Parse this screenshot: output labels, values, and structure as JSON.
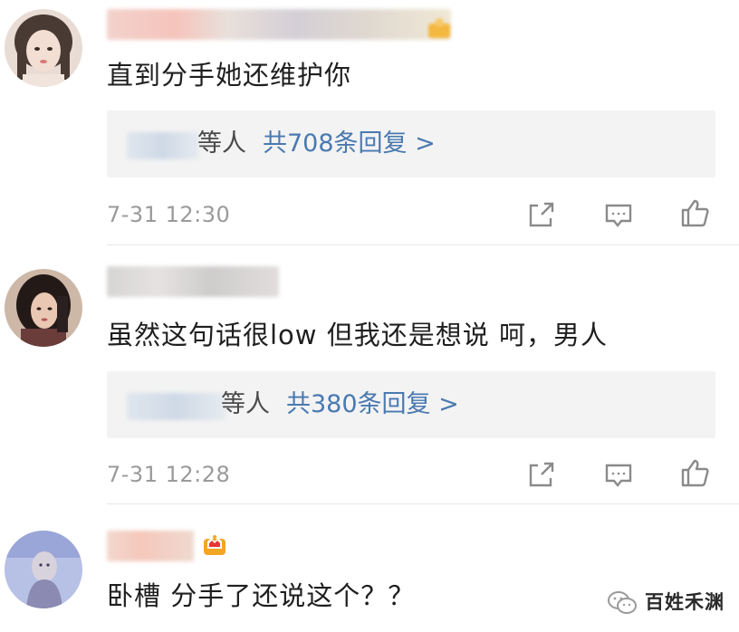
{
  "comments": [
    {
      "text": "直到分手她还维护你",
      "reply_suffix": "等人",
      "reply_count": "共708条回复 >",
      "time": "7-31 12:30"
    },
    {
      "text": "虽然这句话很low  但我还是想说  呵，男人",
      "reply_suffix": "等人",
      "reply_count": "共380条回复 >",
      "time": "7-31 12:28"
    },
    {
      "text": "卧槽  分手了还说这个？？"
    }
  ],
  "icons": {
    "share": "share-icon",
    "comment": "comment-icon",
    "like": "thumbs-up-icon",
    "badge": "crown-badge-icon"
  },
  "watermark": {
    "text": "百姓禾渊"
  },
  "colors": {
    "reply_link": "#4a79b0",
    "reply_bg": "#f3f3f3",
    "time": "#9a9a9a",
    "text": "#1f1f1f"
  }
}
